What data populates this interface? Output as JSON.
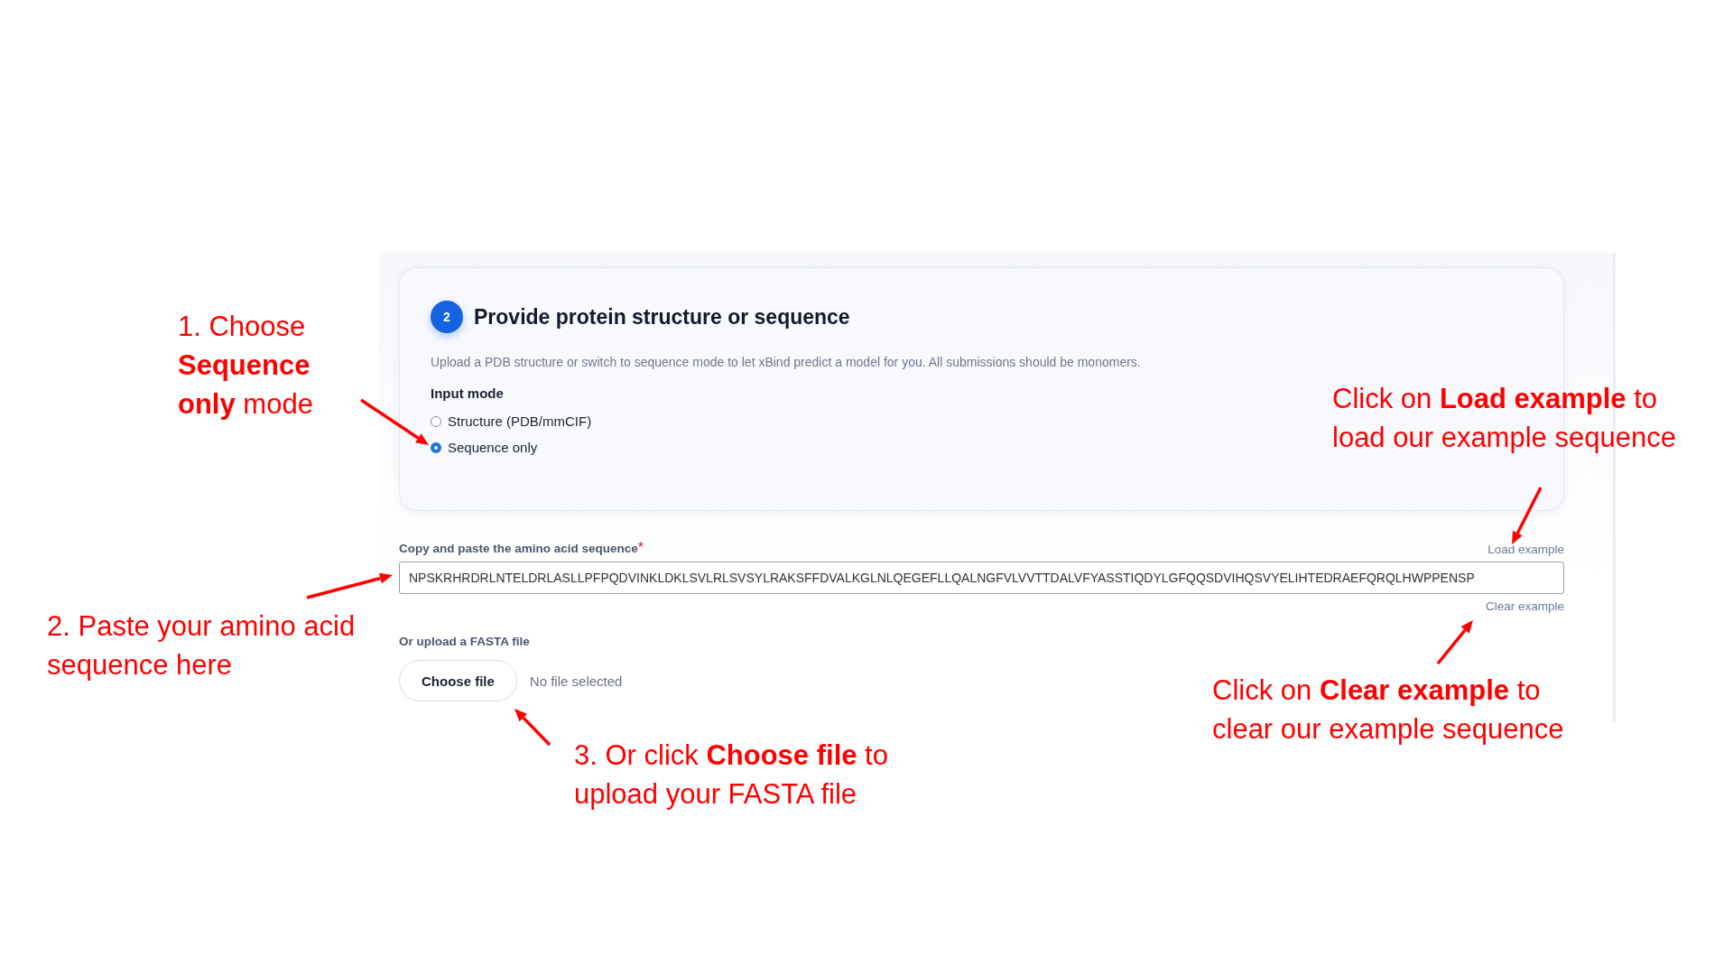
{
  "step": {
    "number": "2",
    "title": "Provide protein structure or sequence",
    "description": "Upload a PDB structure or switch to sequence mode to let xBind predict a model for you. All submissions should be monomers."
  },
  "input_mode": {
    "label": "Input mode",
    "options": [
      {
        "label": "Structure (PDB/mmCIF)",
        "selected": false
      },
      {
        "label": "Sequence only",
        "selected": true
      }
    ]
  },
  "sequence": {
    "label": "Copy and paste the amino acid sequence",
    "required_mark": "*",
    "load_link": "Load example",
    "value": "NPSKRHRDRLNTELDRLASLLPFPQDVINKLDKLSVLRLSVSYLRAKSFFDVALKGLNLQEGEFLLQALNGFVLVVTTDALVFYASSTIQDYLGFQQSDVIHQSVYELIHTEDRAEFQRQLHWPPENSP",
    "clear_link": "Clear example"
  },
  "upload": {
    "label": "Or upload a FASTA file",
    "button": "Choose file",
    "status": "No file selected"
  },
  "annotations": [
    {
      "lines": [
        "1. Choose",
        "**Sequence**",
        "**only** mode"
      ]
    },
    {
      "lines": [
        "2. Paste your amino acid",
        "sequence here"
      ]
    },
    {
      "lines": [
        "3. Or click **Choose file** to",
        "upload your FASTA file"
      ]
    },
    {
      "lines": [
        "Click on **Load example** to",
        "load our example sequence"
      ]
    },
    {
      "lines": [
        "Click on **Clear example** to",
        "clear our example sequence"
      ]
    }
  ]
}
